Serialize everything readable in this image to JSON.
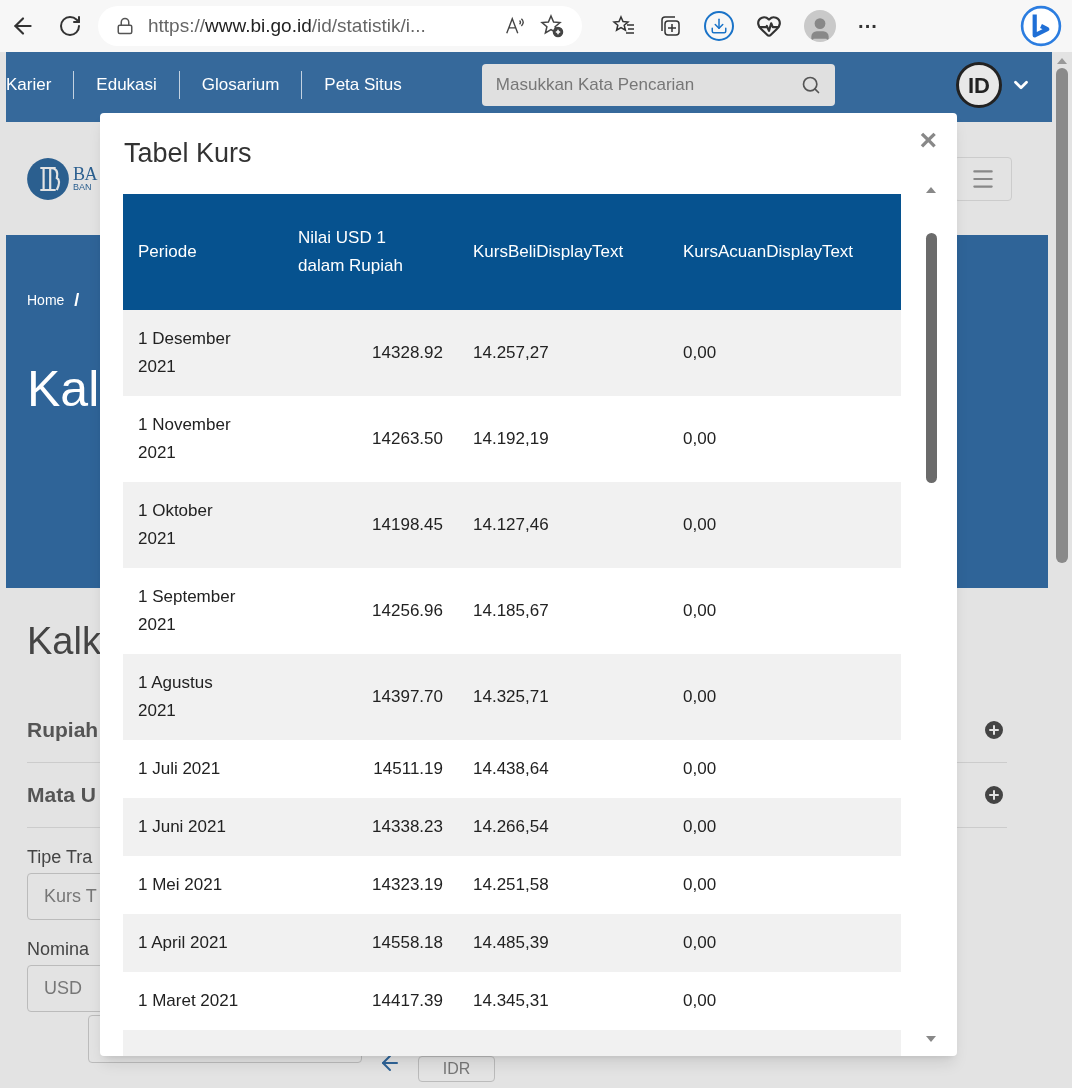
{
  "browser": {
    "address": {
      "scheme": "https://",
      "domain": "www.bi.go.id",
      "path": "/id/statistik/i..."
    },
    "menu_glyph": "···"
  },
  "nav": {
    "links": [
      "Karier",
      "Edukasi",
      "Glosarium",
      "Peta Situs"
    ],
    "search": {
      "placeholder": "Masukkan Kata Pencarian"
    },
    "language": "ID"
  },
  "brand": {
    "name": "BA",
    "subtitle": "BAN"
  },
  "hero": {
    "breadcrumb": "Home",
    "separator": "/",
    "title": "Kal"
  },
  "page": {
    "title": "Kalk",
    "sections": [
      "Rupiah",
      "Mata U"
    ],
    "fields": [
      {
        "label": "Tipe Tra",
        "value": "Kurs T"
      },
      {
        "label": "Nomina",
        "value": "USD"
      }
    ],
    "currency_button": "IDR"
  },
  "modal": {
    "title": "Tabel Kurs",
    "close": "×",
    "table": {
      "columns": [
        "Periode",
        "Nilai USD 1 dalam Rupiah",
        "KursBeliDisplayText",
        "KursAcuanDisplayText"
      ],
      "rows": [
        [
          "1 Desember 2021",
          "14328.92",
          "14.257,27",
          "0,00"
        ],
        [
          "1 November 2021",
          "14263.50",
          "14.192,19",
          "0,00"
        ],
        [
          "1 Oktober 2021",
          "14198.45",
          "14.127,46",
          "0,00"
        ],
        [
          "1 September 2021",
          "14256.96",
          "14.185,67",
          "0,00"
        ],
        [
          "1 Agustus 2021",
          "14397.70",
          "14.325,71",
          "0,00"
        ],
        [
          "1 Juli 2021",
          "14511.19",
          "14.438,64",
          "0,00"
        ],
        [
          "1 Juni 2021",
          "14338.23",
          "14.266,54",
          "0,00"
        ],
        [
          "1 Mei 2021",
          "14323.19",
          "14.251,58",
          "0,00"
        ],
        [
          "1 April 2021",
          "14558.18",
          "14.485,39",
          "0,00"
        ],
        [
          "1 Maret 2021",
          "14417.39",
          "14.345,31",
          "0,00"
        ]
      ]
    }
  }
}
